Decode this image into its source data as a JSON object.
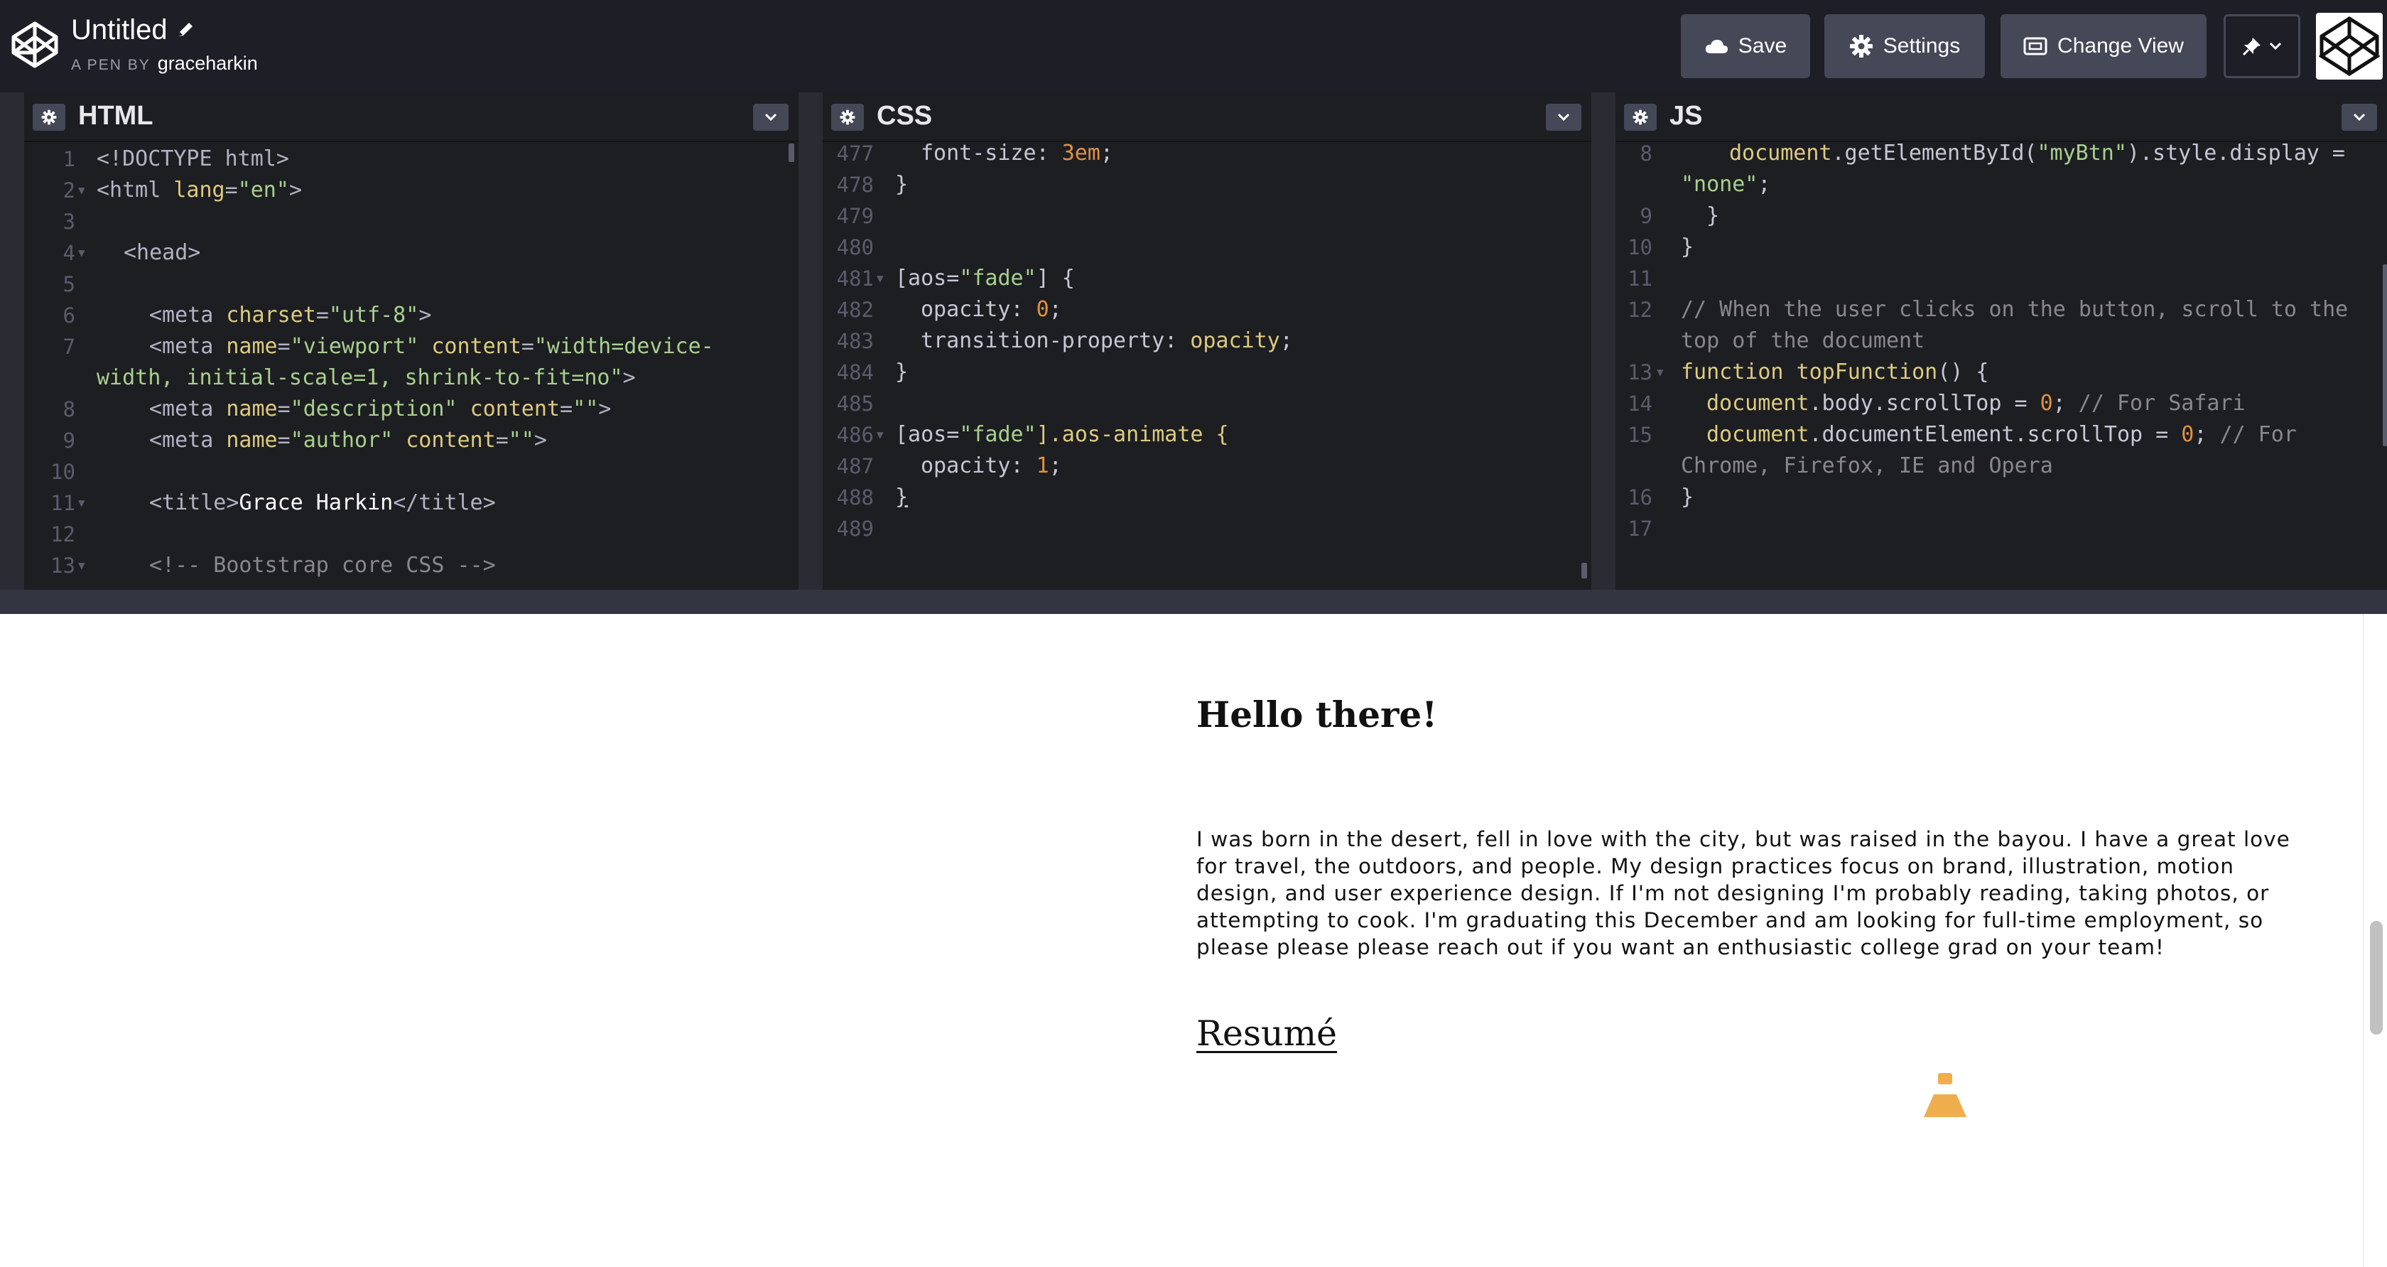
{
  "header": {
    "pen_title": "Untitled",
    "byline_prefix": "A PEN BY",
    "byline_user": "graceharkin",
    "logo_icon": "codepen-logo-icon",
    "pencil_icon": "pencil-icon"
  },
  "toolbar": {
    "save_label": "Save",
    "settings_label": "Settings",
    "change_view_label": "Change View",
    "save_icon": "cloud-icon",
    "settings_icon": "gear-icon",
    "change_view_icon": "view-icon",
    "pin_icon": "pin-icon",
    "pin_chevron_icon": "chevron-down-icon"
  },
  "editors": {
    "html": {
      "title": "HTML",
      "lines": [
        {
          "n": "1",
          "fold": false
        },
        {
          "n": "2",
          "fold": true
        },
        {
          "n": "3",
          "fold": false
        },
        {
          "n": "4",
          "fold": true
        },
        {
          "n": "5",
          "fold": false
        },
        {
          "n": "6",
          "fold": false
        },
        {
          "n": "7",
          "fold": false
        },
        {
          "n": "",
          "fold": false
        },
        {
          "n": "8",
          "fold": false
        },
        {
          "n": "9",
          "fold": false
        },
        {
          "n": "10",
          "fold": false
        },
        {
          "n": "11",
          "fold": true
        },
        {
          "n": "12",
          "fold": false
        },
        {
          "n": "13",
          "fold": true
        }
      ],
      "code": {
        "l1": "<!DOCTYPE html>",
        "l2_tag_open": "<html ",
        "l2_attr": "lang",
        "l2_eq": "=",
        "l2_val": "\"en\"",
        "l2_close": ">",
        "l4": "<head>",
        "l6_open": "<meta ",
        "l6_attr": "charset",
        "l6_val": "\"utf-8\"",
        "l6_close": ">",
        "l7_open": "<meta ",
        "l7_attr1": "name",
        "l7_val1": "\"viewport\"",
        "l7_attr2": "content",
        "l7_val2a": "\"width=device-",
        "l7_val2b": "width, initial-scale=1, shrink-to-fit=no\"",
        "l7_close": ">",
        "l8_open": "<meta ",
        "l8_attr1": "name",
        "l8_val1": "\"description\"",
        "l8_attr2": "content",
        "l8_val2": "\"\"",
        "l8_close": ">",
        "l9_open": "<meta ",
        "l9_attr1": "name",
        "l9_val1": "\"author\"",
        "l9_attr2": "content",
        "l9_val2": "\"\"",
        "l9_close": ">",
        "l11_open": "<title>",
        "l11_text": "Grace Harkin",
        "l11_close": "</title>",
        "l13": "<!-- Bootstrap core CSS -->"
      }
    },
    "css": {
      "title": "CSS",
      "lines": [
        {
          "n": "477",
          "fold": false
        },
        {
          "n": "478",
          "fold": false
        },
        {
          "n": "479",
          "fold": false
        },
        {
          "n": "480",
          "fold": false
        },
        {
          "n": "481",
          "fold": true
        },
        {
          "n": "482",
          "fold": false
        },
        {
          "n": "483",
          "fold": false
        },
        {
          "n": "484",
          "fold": false
        },
        {
          "n": "485",
          "fold": false
        },
        {
          "n": "486",
          "fold": true
        },
        {
          "n": "487",
          "fold": false
        },
        {
          "n": "488",
          "fold": false
        },
        {
          "n": "489",
          "fold": false
        }
      ],
      "code": {
        "l477_prop": "font-size",
        "l477_val": "3em",
        "brace_close": "}",
        "l481_sel_a": "[aos=",
        "l481_sel_str": "\"fade\"",
        "l481_sel_b": "] {",
        "l482_prop": "opacity",
        "l482_val": "0",
        "l483_prop": "transition-property",
        "l483_val": "opacity",
        "l486_sel_a": "[aos=",
        "l486_sel_str": "\"fade\"",
        "l486_sel_b": "].aos-animate {",
        "l487_prop": "opacity",
        "l487_val": "1"
      }
    },
    "js": {
      "title": "JS",
      "lines": [
        {
          "n": "8",
          "fold": false
        },
        {
          "n": "",
          "fold": false
        },
        {
          "n": "9",
          "fold": false
        },
        {
          "n": "10",
          "fold": false
        },
        {
          "n": "11",
          "fold": false
        },
        {
          "n": "12",
          "fold": false
        },
        {
          "n": "",
          "fold": false
        },
        {
          "n": "13",
          "fold": true
        },
        {
          "n": "14",
          "fold": false
        },
        {
          "n": "15",
          "fold": false
        },
        {
          "n": "",
          "fold": false
        },
        {
          "n": "16",
          "fold": false
        },
        {
          "n": "17",
          "fold": false
        }
      ],
      "code": {
        "l8_obj": "document",
        "l8_call": ".getElementById(",
        "l8_str": "\"myBtn\"",
        "l8_rest": ").style.display =",
        "l8b_str": "\"none\"",
        "semi": ";",
        "brace_close": "}",
        "l12a": "// When the user clicks on the button, scroll to the",
        "l12b": "top of the document",
        "l13_kw": "function ",
        "l13_fn": "topFunction",
        "l13_rest": "() {",
        "l14_obj": "document",
        "l14_mid": ".body.scrollTop = ",
        "l14_num": "0",
        "l14_com": "// For Safari",
        "l15_obj": "document",
        "l15_mid": ".documentElement.scrollTop = ",
        "l15_num": "0",
        "l15_com_a": "// For",
        "l15_com_b": "Chrome, Firefox, IE and Opera"
      }
    },
    "gear_icon": "gear-icon",
    "collapse_icon": "chevron-down-icon"
  },
  "preview": {
    "heading": "Hello there!",
    "bio": "I was born in the desert, fell in love with the city, but was raised in the bayou. I have a great love for travel, the outdoors, and people. My design practices focus on brand, illustration, motion design, and user experience design. If I'm not designing I'm probably reading, taking photos, or attempting to cook. I'm graduating this December and am looking for full-time employment, so please please please reach out if you want an enthusiastic college grad on your team!",
    "resume_link": "Resumé",
    "up_button_icon": "scroll-to-top-icon",
    "accent_color": "#f0ad4e"
  }
}
